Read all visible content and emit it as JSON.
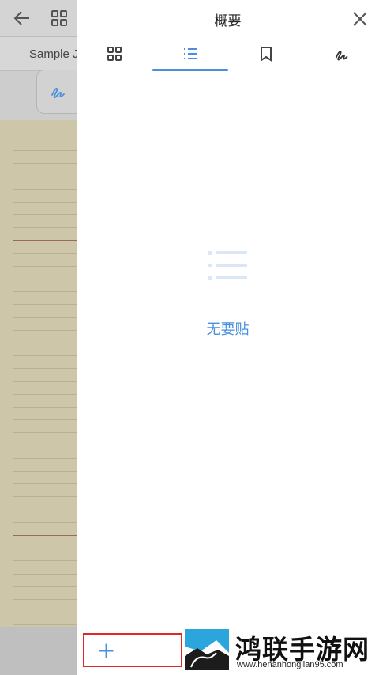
{
  "background": {
    "tab_label": "Sample J",
    "icons": [
      "back-arrow-icon",
      "grid-icon",
      "pen-icon"
    ]
  },
  "panel": {
    "title": "概要",
    "close_icon": "close-icon",
    "tabs": [
      {
        "name": "thumbnails",
        "icon": "grid-icon"
      },
      {
        "name": "outline",
        "icon": "list-icon",
        "selected": true
      },
      {
        "name": "bookmarks",
        "icon": "bookmark-icon"
      },
      {
        "name": "annotations",
        "icon": "pen-icon"
      }
    ],
    "empty_state": {
      "icon": "list-icon",
      "text": "无要贴"
    },
    "add_button": {
      "label": "+"
    }
  },
  "watermark": {
    "title": "鸿联手游网",
    "url": "www.henanhonglian95.com"
  },
  "colors": {
    "accent": "#4a8fde",
    "highlight_border": "#e02828",
    "paper": "#cdc6a8"
  }
}
